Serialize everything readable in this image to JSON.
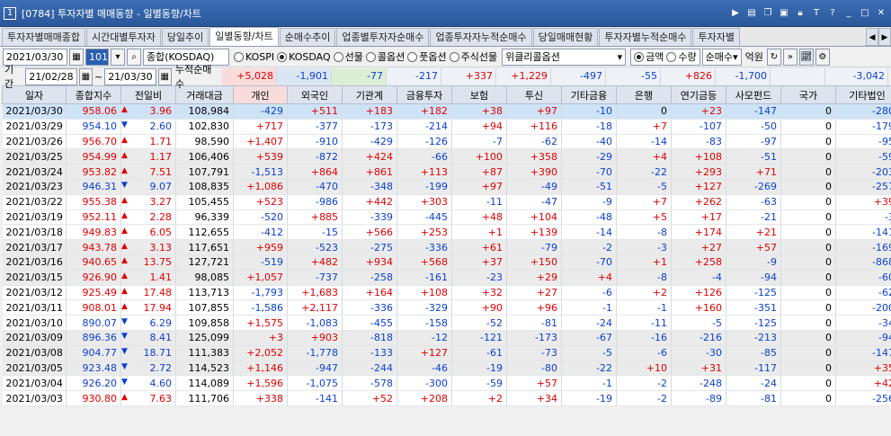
{
  "window": {
    "number": "1",
    "title": "[0784] 투자자별 매매동향 - 일별동향/차트",
    "icons": [
      "arrow-right",
      "menu",
      "restore",
      "image",
      "lock",
      "font",
      "help",
      "minimize",
      "maximize",
      "close"
    ]
  },
  "tabs": [
    "투자자별매매종합",
    "시간대별투자자",
    "당일추이",
    "일별동향/차트",
    "순매수추이",
    "업종별투자자순매수",
    "업종투자자누적순매수",
    "당일매매현황",
    "투자자별누적순매수",
    "투자자별"
  ],
  "active_tab": "일별동향/차트",
  "controls": {
    "date": "2021/03/30",
    "market_code": "101",
    "market_name": "종합(KOSDAQ)",
    "radios": [
      {
        "label": "KOSPI",
        "on": false
      },
      {
        "label": "KOSDAQ",
        "on": true
      },
      {
        "label": "선물",
        "on": false
      },
      {
        "label": "콜옵션",
        "on": false
      },
      {
        "label": "풋옵션",
        "on": false
      },
      {
        "label": "주식선물",
        "on": false
      }
    ],
    "option_select": "위클리콜옵션",
    "amount_radios": [
      {
        "label": "금액",
        "on": true
      },
      {
        "label": "수량",
        "on": false
      }
    ],
    "net_select": "순매수",
    "unit": "억원"
  },
  "period": {
    "label": "기간",
    "from": "21/02/28",
    "to": "21/03/30",
    "cum_label": "누적순매수",
    "sums": [
      "+5,028",
      "-1,901",
      "-77",
      "-217",
      "+337",
      "+1,229",
      "-497",
      "-55",
      "+826",
      "-1,700",
      "",
      "-3,042"
    ]
  },
  "columns": [
    "일자",
    "종합지수",
    "전일비",
    "거래대금",
    "개인",
    "외국인",
    "기관계",
    "금융투자",
    "보험",
    "투신",
    "기타금융",
    "은행",
    "연기금등",
    "사모펀드",
    "국가",
    "기타법인"
  ],
  "rows": [
    [
      "2021/03/30",
      "958.06",
      "▲",
      "3.96",
      "108,984",
      "-429",
      "+511",
      "+183",
      "+182",
      "+38",
      "+97",
      "-10",
      "0",
      "+23",
      "-147",
      "0",
      "-280"
    ],
    [
      "2021/03/29",
      "954.10",
      "▼",
      "2.60",
      "102,830",
      "+717",
      "-377",
      "-173",
      "-214",
      "+94",
      "+116",
      "-18",
      "+7",
      "-107",
      "-50",
      "0",
      "-179"
    ],
    [
      "2021/03/26",
      "956.70",
      "▲",
      "1.71",
      "98,590",
      "+1,407",
      "-910",
      "-429",
      "-126",
      "-7",
      "-62",
      "-40",
      "-14",
      "-83",
      "-97",
      "0",
      "-95"
    ],
    [
      "2021/03/25",
      "954.99",
      "▲",
      "1.17",
      "106,406",
      "+539",
      "-872",
      "+424",
      "-66",
      "+100",
      "+358",
      "-29",
      "+4",
      "+108",
      "-51",
      "0",
      "-59"
    ],
    [
      "2021/03/24",
      "953.82",
      "▲",
      "7.51",
      "107,791",
      "-1,513",
      "+864",
      "+861",
      "+113",
      "+87",
      "+390",
      "-70",
      "-22",
      "+293",
      "+71",
      "0",
      "-203"
    ],
    [
      "2021/03/23",
      "946.31",
      "▼",
      "9.07",
      "108,835",
      "+1,086",
      "-470",
      "-348",
      "-199",
      "+97",
      "-49",
      "-51",
      "-5",
      "+127",
      "-269",
      "0",
      "-257"
    ],
    [
      "2021/03/22",
      "955.38",
      "▲",
      "3.27",
      "105,455",
      "+523",
      "-986",
      "+442",
      "+303",
      "-11",
      "-47",
      "-9",
      "+7",
      "+262",
      "-63",
      "0",
      "+39"
    ],
    [
      "2021/03/19",
      "952.11",
      "▲",
      "2.28",
      "96,339",
      "-520",
      "+885",
      "-339",
      "-445",
      "+48",
      "+104",
      "-48",
      "+5",
      "+17",
      "-21",
      "0",
      "-3"
    ],
    [
      "2021/03/18",
      "949.83",
      "▲",
      "6.05",
      "112,655",
      "-412",
      "-15",
      "+566",
      "+253",
      "+1",
      "+139",
      "-14",
      "-8",
      "+174",
      "+21",
      "0",
      "-141"
    ],
    [
      "2021/03/17",
      "943.78",
      "▲",
      "3.13",
      "117,651",
      "+959",
      "-523",
      "-275",
      "-336",
      "+61",
      "-79",
      "-2",
      "-3",
      "+27",
      "+57",
      "0",
      "-169"
    ],
    [
      "2021/03/16",
      "940.65",
      "▲",
      "13.75",
      "127,721",
      "-519",
      "+482",
      "+934",
      "+568",
      "+37",
      "+150",
      "-70",
      "+1",
      "+258",
      "-9",
      "0",
      "-868"
    ],
    [
      "2021/03/15",
      "926.90",
      "▲",
      "1.41",
      "98,085",
      "+1,057",
      "-737",
      "-258",
      "-161",
      "-23",
      "+29",
      "+4",
      "-8",
      "-4",
      "-94",
      "0",
      "-60"
    ],
    [
      "2021/03/12",
      "925.49",
      "▲",
      "17.48",
      "113,713",
      "-1,793",
      "+1,683",
      "+164",
      "+108",
      "+32",
      "+27",
      "-6",
      "+2",
      "+126",
      "-125",
      "0",
      "-62"
    ],
    [
      "2021/03/11",
      "908.01",
      "▲",
      "17.94",
      "107,855",
      "-1,586",
      "+2,117",
      "-336",
      "-329",
      "+90",
      "+96",
      "-1",
      "-1",
      "+160",
      "-351",
      "0",
      "-200"
    ],
    [
      "2021/03/10",
      "890.07",
      "▼",
      "6.29",
      "109,858",
      "+1,575",
      "-1,083",
      "-455",
      "-158",
      "-52",
      "-81",
      "-24",
      "-11",
      "-5",
      "-125",
      "0",
      "-34"
    ],
    [
      "2021/03/09",
      "896.36",
      "▼",
      "8.41",
      "125,099",
      "+3",
      "+903",
      "-818",
      "-12",
      "-121",
      "-173",
      "-67",
      "-16",
      "-216",
      "-213",
      "0",
      "-94"
    ],
    [
      "2021/03/08",
      "904.77",
      "▼",
      "18.71",
      "111,383",
      "+2,052",
      "-1,778",
      "-133",
      "+127",
      "-61",
      "-73",
      "-5",
      "-6",
      "-30",
      "-85",
      "0",
      "-147"
    ],
    [
      "2021/03/05",
      "923.48",
      "▼",
      "2.72",
      "114,523",
      "+1,146",
      "-947",
      "-244",
      "-46",
      "-19",
      "-80",
      "-22",
      "+10",
      "+31",
      "-117",
      "0",
      "+35"
    ],
    [
      "2021/03/04",
      "926.20",
      "▼",
      "4.60",
      "114,089",
      "+1,596",
      "-1,075",
      "-578",
      "-300",
      "-59",
      "+57",
      "-1",
      "-2",
      "-248",
      "-24",
      "0",
      "+42"
    ],
    [
      "2021/03/03",
      "930.80",
      "▲",
      "7.63",
      "111,706",
      "+338",
      "-141",
      "+52",
      "+208",
      "+2",
      "+34",
      "-19",
      "-2",
      "-89",
      "-81",
      "0",
      "-256"
    ]
  ],
  "colors": {
    "up": "#e00000",
    "down": "#0b3fd1",
    "selected_row": "#cfe3f7",
    "alt_row": "#ebebeb",
    "header": "#dde4ee",
    "title_bar": "#2f5fa5"
  }
}
